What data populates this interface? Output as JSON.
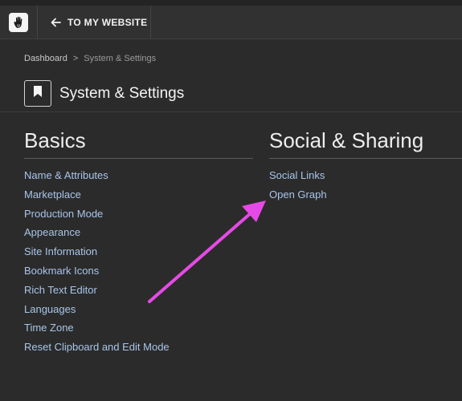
{
  "topbar": {
    "logo_icon": "concrete-hand-logo-icon",
    "back_label": "TO MY WEBSITE",
    "back_icon": "arrow-left-icon"
  },
  "breadcrumb": {
    "items": [
      "Dashboard",
      "System & Settings"
    ],
    "separator": ">"
  },
  "page": {
    "title": "System & Settings",
    "title_icon": "bookmark-icon"
  },
  "sections": [
    {
      "heading": "Basics",
      "links": [
        "Name & Attributes",
        "Marketplace",
        "Production Mode",
        "Appearance",
        "Site Information",
        "Bookmark Icons",
        "Rich Text Editor",
        "Languages",
        "Time Zone",
        "Reset Clipboard and Edit Mode"
      ]
    },
    {
      "heading": "Social & Sharing",
      "links": [
        "Social Links",
        "Open Graph"
      ]
    }
  ],
  "annotation": {
    "type": "arrow",
    "color": "#e64ae6",
    "points_to": "Open Graph"
  },
  "colors": {
    "background": "#2b2b2b",
    "topbar": "#313131",
    "link": "#a9c5ea",
    "heading": "#ededed"
  }
}
